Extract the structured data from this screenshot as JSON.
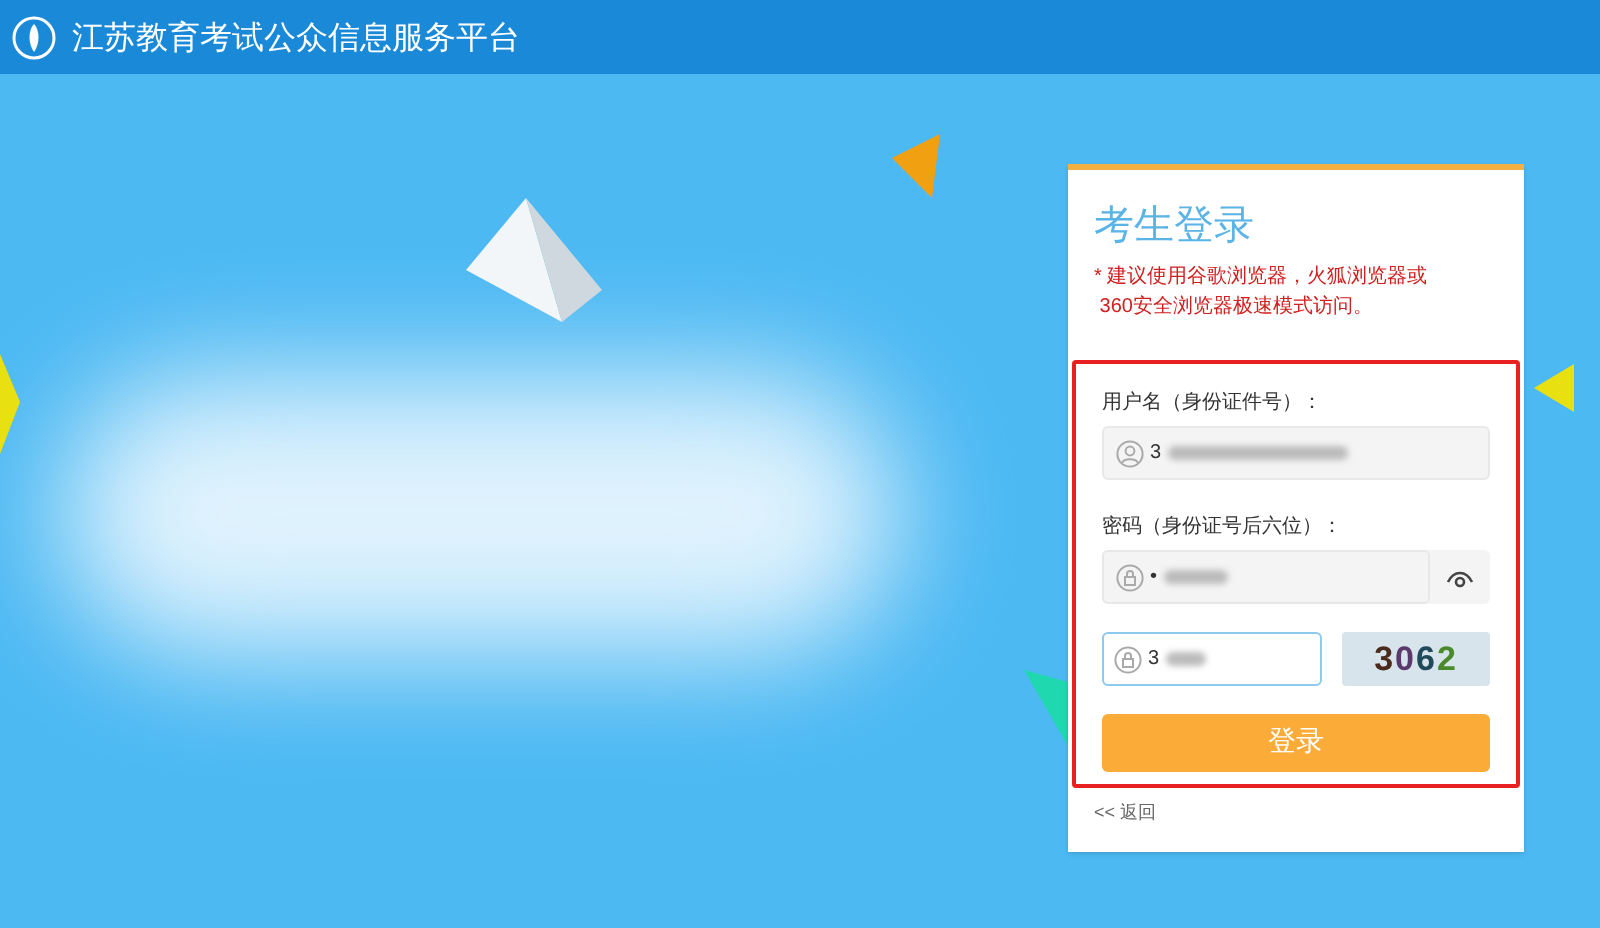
{
  "header": {
    "title": "江苏教育考试公众信息服务平台"
  },
  "login": {
    "title": "考生登录",
    "notice": "* 建议使用谷歌浏览器，火狐浏览器或\n 360安全浏览器极速模式访问。",
    "username": {
      "label": "用户名（身份证件号）：",
      "value": "3"
    },
    "password": {
      "label": "密码（身份证号后六位）：",
      "value": "•"
    },
    "captcha": {
      "value": "3",
      "code": "3062"
    },
    "submit": "登录",
    "back": "<< 返回"
  }
}
